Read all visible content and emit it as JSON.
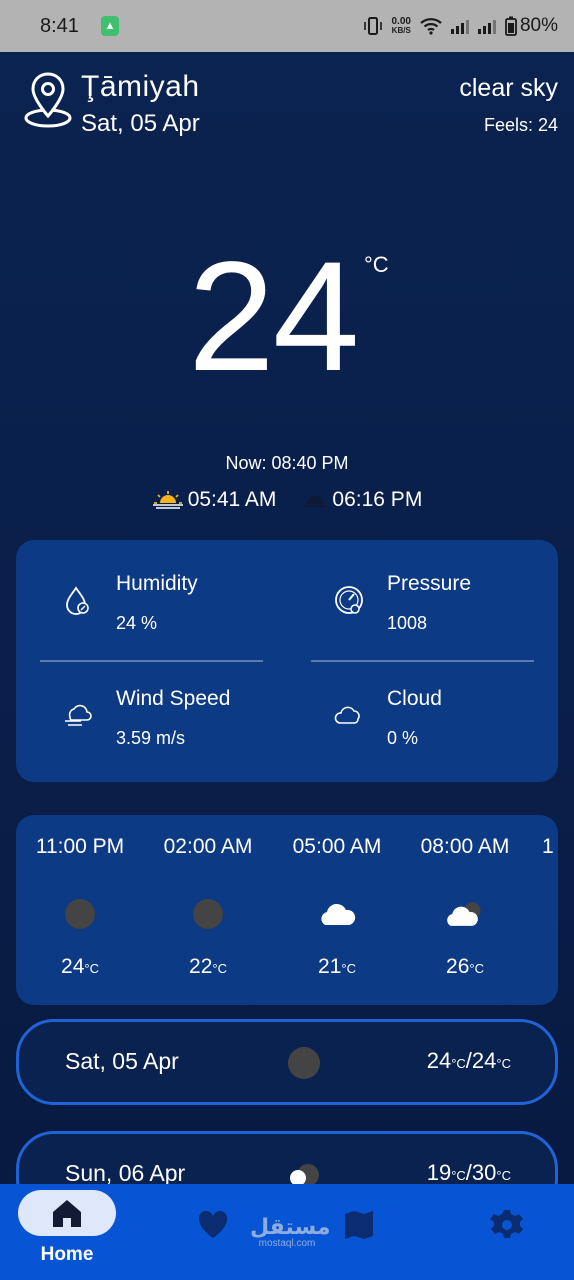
{
  "status_bar": {
    "time": "8:41",
    "net_speed_value": "0.00",
    "net_speed_unit": "KB/S",
    "battery": "80%"
  },
  "header": {
    "city": "Ţāmiyah",
    "date": "Sat, 05 Apr",
    "condition": "clear sky",
    "feels_like": "Feels: 24"
  },
  "current": {
    "temperature": "24",
    "unit": "°C",
    "now": "Now: 08:40 PM",
    "sunrise": "05:41 AM",
    "sunset": "06:16 PM"
  },
  "details": [
    {
      "label": "Humidity",
      "value": "24 %",
      "icon": "humidity-icon"
    },
    {
      "label": "Pressure",
      "value": "1008",
      "icon": "pressure-icon"
    },
    {
      "label": "Wind Speed",
      "value": "3.59 m/s",
      "icon": "wind-icon"
    },
    {
      "label": "Cloud",
      "value": "0 %",
      "icon": "cloud-icon"
    }
  ],
  "hourly": [
    {
      "time": "11:00 PM",
      "temp": "24",
      "unit": "°C",
      "icon": "moon-icon"
    },
    {
      "time": "02:00 AM",
      "temp": "22",
      "unit": "°C",
      "icon": "moon-icon"
    },
    {
      "time": "05:00 AM",
      "temp": "21",
      "unit": "°C",
      "icon": "cloud-icon"
    },
    {
      "time": "08:00 AM",
      "temp": "26",
      "unit": "°C",
      "icon": "partly-cloudy-icon"
    },
    {
      "time": "1",
      "temp": "",
      "unit": "",
      "icon": ""
    }
  ],
  "daily": [
    {
      "date": "Sat, 05 Apr",
      "temp_max": "24",
      "temp_min": "24",
      "unit": "°C",
      "icon": "moon-icon"
    },
    {
      "date": "Sun, 06 Apr",
      "temp_max": "19",
      "temp_min": "30",
      "unit": "°C",
      "icon": "partly-cloudy-icon"
    }
  ],
  "nav": {
    "home_label": "Home",
    "items": [
      "home-icon",
      "heart-icon",
      "map-icon",
      "gear-icon"
    ]
  },
  "watermark": {
    "line1": "مستقل",
    "line2": "mostaql.com"
  },
  "colors": {
    "background": "#0a1f4e",
    "card": "#0d3a85",
    "nav": "#0755d4",
    "day_border": "#1f63d6"
  }
}
